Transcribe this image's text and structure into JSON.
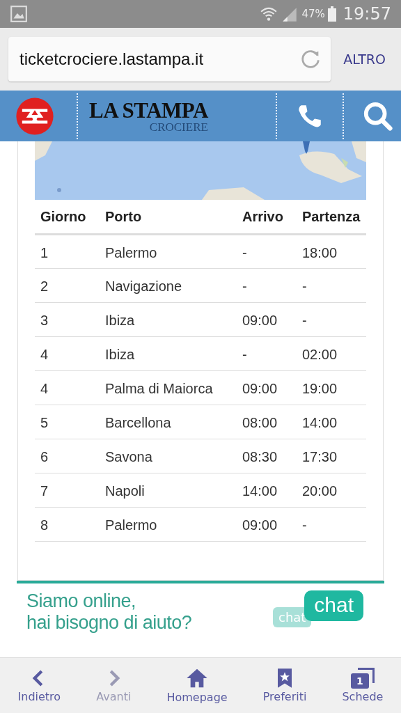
{
  "status_bar": {
    "battery": "47%",
    "time": "19:57"
  },
  "browser": {
    "url": "ticketcrociere.lastampa.it",
    "menu": "ALTRO"
  },
  "site_header": {
    "brand": "LA STAMPA",
    "subbrand": "CROCIERE"
  },
  "itinerary": {
    "columns": [
      "Giorno",
      "Porto",
      "Arrivo",
      "Partenza"
    ],
    "rows": [
      [
        "1",
        "Palermo",
        "-",
        "18:00"
      ],
      [
        "2",
        "Navigazione",
        "-",
        "-"
      ],
      [
        "3",
        "Ibiza",
        "09:00",
        "-"
      ],
      [
        "4",
        "Ibiza",
        "-",
        "02:00"
      ],
      [
        "4",
        "Palma di Maiorca",
        "09:00",
        "19:00"
      ],
      [
        "5",
        "Barcellona",
        "08:00",
        "14:00"
      ],
      [
        "6",
        "Savona",
        "08:30",
        "17:30"
      ],
      [
        "7",
        "Napoli",
        "14:00",
        "20:00"
      ],
      [
        "8",
        "Palermo",
        "09:00",
        "-"
      ]
    ]
  },
  "chat_banner": {
    "lines": [
      "Siamo online,",
      "hai bisogno di aiuto?"
    ],
    "back_bubble": "chat",
    "front_bubble": "chat"
  },
  "bottom_nav": [
    {
      "kind": "back",
      "label": "Indietro",
      "disabled": false
    },
    {
      "kind": "forward",
      "label": "Avanti",
      "disabled": true
    },
    {
      "kind": "home",
      "label": "Homepage",
      "disabled": false
    },
    {
      "kind": "bookmarks",
      "label": "Preferiti",
      "disabled": false
    },
    {
      "kind": "tabs",
      "label": "Schede",
      "disabled": false,
      "badge": "1"
    }
  ]
}
